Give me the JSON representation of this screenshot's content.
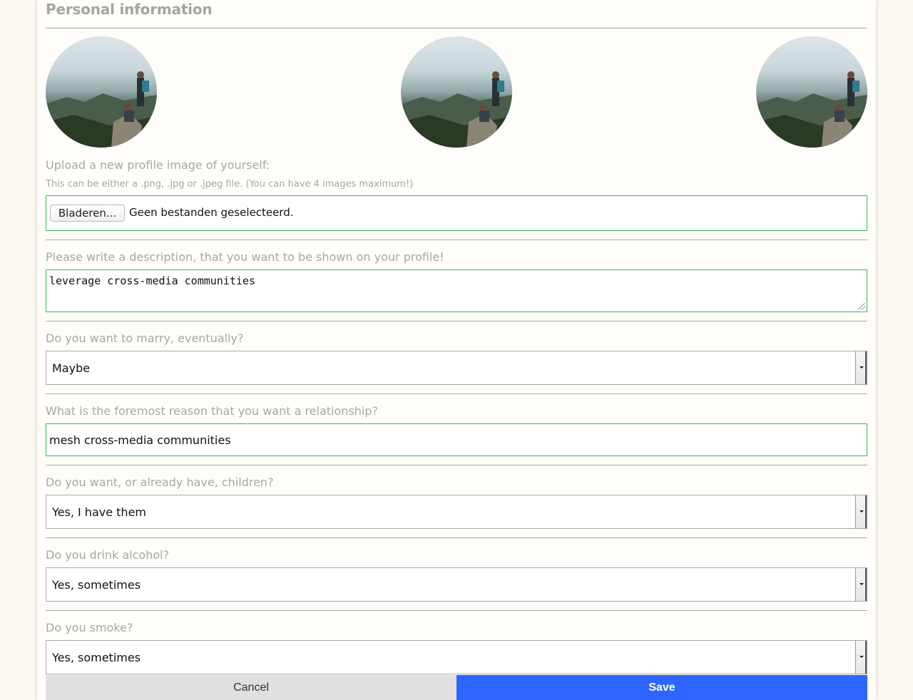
{
  "section": {
    "title": "Personal information"
  },
  "avatars": [
    {
      "alt": "profile-image-1"
    },
    {
      "alt": "profile-image-2"
    },
    {
      "alt": "profile-image-3"
    }
  ],
  "upload": {
    "label": "Upload a new profile image of yourself:",
    "hint": "This can be either a .png, .jpg or .jpeg file. (You can have 4 images maximum!)",
    "button_label": "Bladeren...",
    "status": "Geen bestanden geselecteerd."
  },
  "description": {
    "label": "Please write a description, that you want to be shown on your profile!",
    "value": "leverage cross-media communities"
  },
  "marry": {
    "label": "Do you want to marry, eventually?",
    "value": "Maybe"
  },
  "reason": {
    "label": "What is the foremost reason that you want a relationship?",
    "value": "mesh cross-media communities"
  },
  "children": {
    "label": "Do you want, or already have, children?",
    "value": "Yes, I have them"
  },
  "alcohol": {
    "label": "Do you drink alcohol?",
    "value": "Yes, sometimes"
  },
  "smoke": {
    "label": "Do you smoke?",
    "value": "Yes, sometimes"
  },
  "actions": {
    "cancel": "Cancel",
    "save": "Save"
  },
  "colors": {
    "accent_green": "#39b54a",
    "save_blue": "#2d66ff"
  }
}
